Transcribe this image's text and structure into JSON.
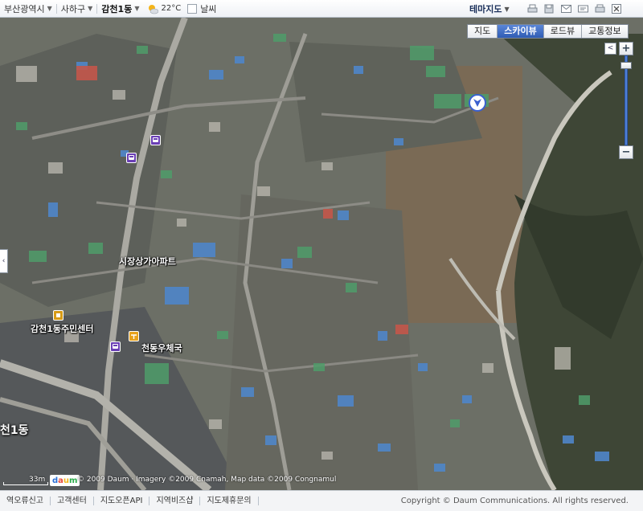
{
  "topbar": {
    "breadcrumb": [
      {
        "label": "부산광역시"
      },
      {
        "label": "사하구"
      },
      {
        "label": "감천1동"
      }
    ],
    "weather": {
      "temperature": "22°C",
      "icon": "sun-cloud-icon"
    },
    "weather_toggle_label": "날씨",
    "theme_label": "테마지도",
    "tools": [
      "print-icon",
      "save-icon",
      "mail-icon",
      "link-icon",
      "print-preview-icon",
      "close-icon"
    ]
  },
  "maptypes": [
    {
      "label": "지도",
      "active": false
    },
    {
      "label": "스카이뷰",
      "active": true
    },
    {
      "label": "로드뷰",
      "active": false
    },
    {
      "label": "교통정보",
      "active": false
    }
  ],
  "zoom": {
    "in_label": "+",
    "out_label": "−",
    "collapse_label": "<"
  },
  "map_labels": {
    "apartment": "시장상가아파트",
    "community_center": "감천1동주민센터",
    "post_office": "천동우체국",
    "district": "천1동"
  },
  "scale": {
    "value": "33m"
  },
  "logo": "daum",
  "map_copyright": "© 2009 Daum · Imagery ©2009 Cnamah, Map data ©2009 Congnamul",
  "footer": {
    "links": [
      "역오류신고",
      "고객센터",
      "지도오픈API",
      "지역비즈샵",
      "지도제휴문의"
    ],
    "copyright": "Copyright © Daum Communications. All rights reserved."
  },
  "colors": {
    "accent": "#2f5cb3",
    "zoom_bar": "#4f7fd4"
  }
}
